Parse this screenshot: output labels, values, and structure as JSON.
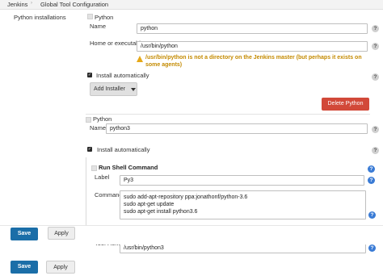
{
  "breadcrumb": {
    "items": [
      "Jenkins",
      "Global Tool Configuration"
    ],
    "separator": "›"
  },
  "python_installations": {
    "section_label": "Python installations",
    "first": {
      "header": "Python",
      "name_label": "Name",
      "name_value": "python",
      "home_label": "Home or executable",
      "home_value": "/usr/bin/python",
      "warning": "/usr/bin/python is not a directory on the Jenkins master (but perhaps it exists on some agents)",
      "install_auto_label": "Install automatically",
      "install_auto_checked": true,
      "add_installer_label": "Add Installer",
      "delete_label": "Delete Python"
    },
    "second": {
      "header": "Python",
      "name_label": "Name",
      "name_value": "python3",
      "install_auto_label": "Install automatically",
      "install_auto_checked": true,
      "installer": {
        "title": "Run Shell Command",
        "label_label": "Label",
        "label_value": "Py3",
        "command_label": "Command",
        "command_value": "sudo add-apt-repository ppa:jonathonf/python-3.6\nsudo apt-get update\nsudo apt-get install python3.6"
      },
      "tool_home_label": "Tool Home",
      "tool_home_value": "/usr/bin/python3"
    }
  },
  "buttons": {
    "save_label": "Save",
    "apply_label": "Apply"
  },
  "icons": {
    "help": "?",
    "warning": "warning-icon",
    "check": "✓"
  },
  "colors": {
    "delete_button": "#d24939",
    "save_button": "#1b6ea8",
    "warning_text": "#c48a00",
    "help_icon_active": "#3a7bd5"
  }
}
